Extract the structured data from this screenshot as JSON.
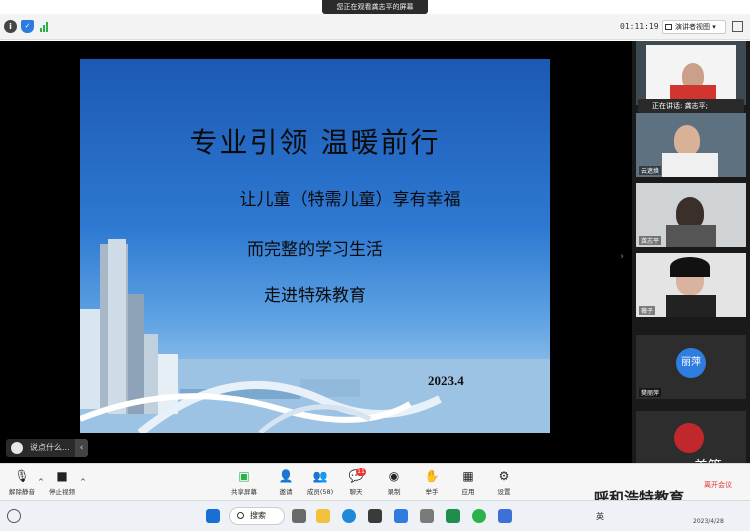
{
  "banner": {
    "text": "您正在观看龚志平的屏幕"
  },
  "topbar": {
    "timer": "01:11:19",
    "view_label": "演讲者视图"
  },
  "slide": {
    "title": "专业引领  温暖前行",
    "line1": "让儿童（特需儿童）享有幸福",
    "line2": "而完整的学习生活",
    "line3": "走进特殊教育",
    "date": "2023.4"
  },
  "caption": {
    "text": "说点什么..."
  },
  "sidebar": {
    "speaker_text": "正在讲话: 龚志平;",
    "participants": [
      {
        "name": "云遮焕"
      },
      {
        "name": "龚志平"
      },
      {
        "name": "薇子"
      },
      {
        "name": "樊丽萍",
        "avatar_text": "丽萍"
      }
    ],
    "meipian": "美篇"
  },
  "toolbar": {
    "mute": "解除静音",
    "video": "停止视频",
    "share": "共享屏幕",
    "invite": "邀请",
    "members": "成员(58)",
    "chat": "聊天",
    "chat_badge": "11",
    "record": "录制",
    "raise_hand": "举手",
    "apps": "应用",
    "settings": "设置",
    "leave": "离开会议"
  },
  "watermark": "呼和浩特教育",
  "taskbar": {
    "search": "搜索",
    "ime": "英",
    "date": "2023/4/28"
  }
}
